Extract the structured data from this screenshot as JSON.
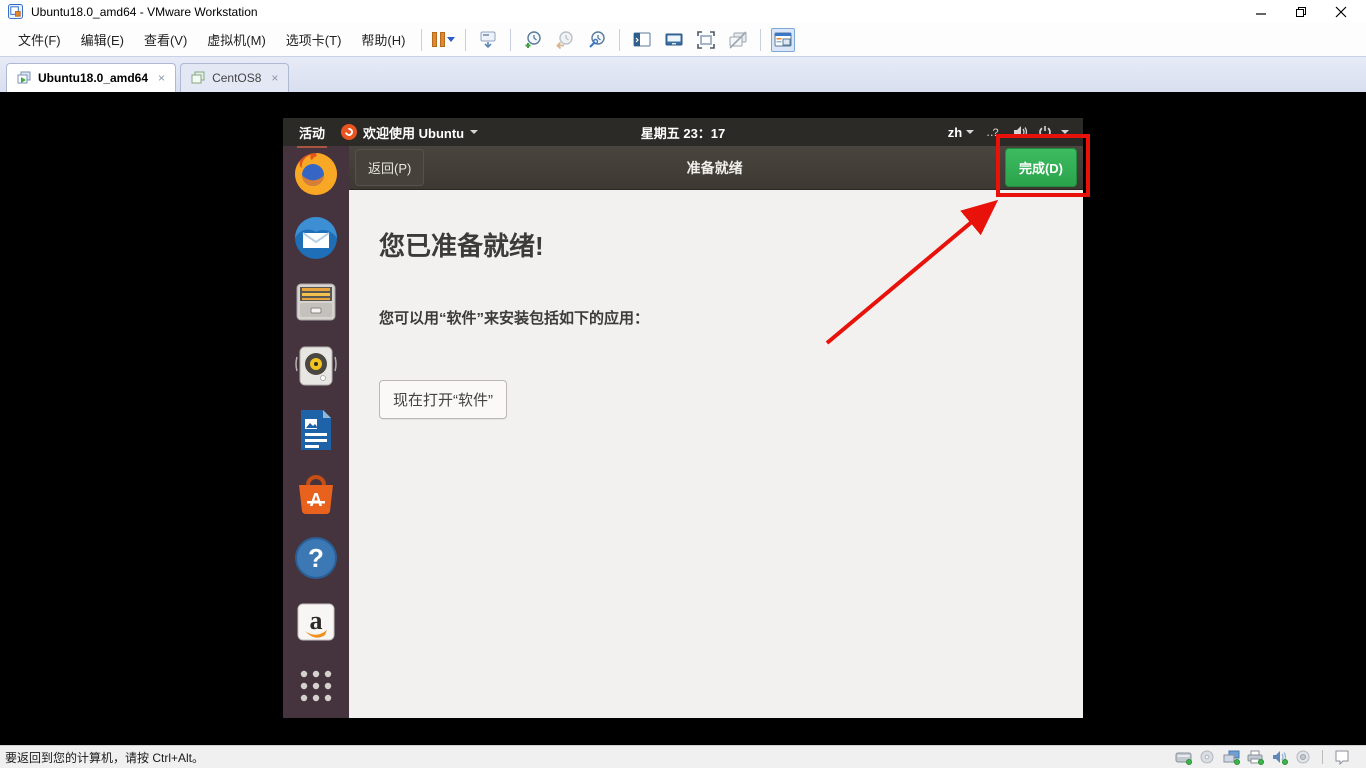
{
  "title_bar": {
    "title": "Ubuntu18.0_amd64 - VMware Workstation",
    "app_icon": "vmware-icon"
  },
  "menu_bar": {
    "items": [
      {
        "label": "文件(F)"
      },
      {
        "label": "编辑(E)"
      },
      {
        "label": "查看(V)"
      },
      {
        "label": "虚拟机(M)"
      },
      {
        "label": "选项卡(T)"
      },
      {
        "label": "帮助(H)"
      }
    ]
  },
  "toolbar": {
    "icons": [
      "suspend-pause-icon",
      "suspend-caret-icon",
      "send-ctrl-alt-del-icon",
      "snapshot-take-icon",
      "snapshot-revert-icon",
      "snapshot-manager-icon",
      "console-view-icon",
      "unity-mode-icon",
      "fullscreen-icon",
      "cycle-monitors-icon",
      "library-toggle-icon"
    ]
  },
  "tab_bar": {
    "tabs": [
      {
        "label": "Ubuntu18.0_amd64",
        "active": true,
        "close": "×"
      },
      {
        "label": "CentOS8",
        "active": false,
        "close": "×"
      }
    ]
  },
  "guest": {
    "top_bar": {
      "activities_label": "活动",
      "app_menu_label": "欢迎使用 Ubuntu",
      "clock": "星期五 23：17",
      "language": "zh",
      "system_icons": [
        "network-question-icon",
        "volume-icon",
        "power-icon",
        "caret-down-icon"
      ]
    },
    "dock": {
      "items": [
        {
          "icon": "firefox-icon"
        },
        {
          "icon": "thunderbird-icon"
        },
        {
          "icon": "files-icon"
        },
        {
          "icon": "rhythmbox-icon"
        },
        {
          "icon": "libreoffice-writer-icon"
        },
        {
          "icon": "ubuntu-software-icon",
          "glyph": "A"
        },
        {
          "icon": "help-icon",
          "glyph": "?"
        },
        {
          "icon": "amazon-icon",
          "glyph": "a"
        },
        {
          "icon": "app-grid-icon"
        }
      ]
    },
    "setup_window": {
      "back_label": "返回(P)",
      "title": "准备就绪",
      "done_label": "完成(D)",
      "heading": "您已准备就绪!",
      "description": "您可以用“软件”来安装包括如下的应用：",
      "open_software_label": "现在打开“软件”"
    }
  },
  "status_bar": {
    "message": "要返回到您的计算机，请按 Ctrl+Alt。",
    "tray_icons": [
      "hard-disk-icon",
      "cd-rom-icon",
      "network-adapter-icon",
      "printer-icon",
      "sound-icon",
      "usb-device-icon",
      "message-log-icon"
    ]
  },
  "annotation": {
    "highlight_color": "#e8120b",
    "type": "red box around done button with arrow"
  },
  "colors": {
    "done_button_green": "#2ba44c",
    "ubuntu_orange": "#e95420",
    "gnome_topbar": "#2c2a26",
    "dock_bg": "#45343e",
    "content_bg": "#f2f1ef"
  }
}
